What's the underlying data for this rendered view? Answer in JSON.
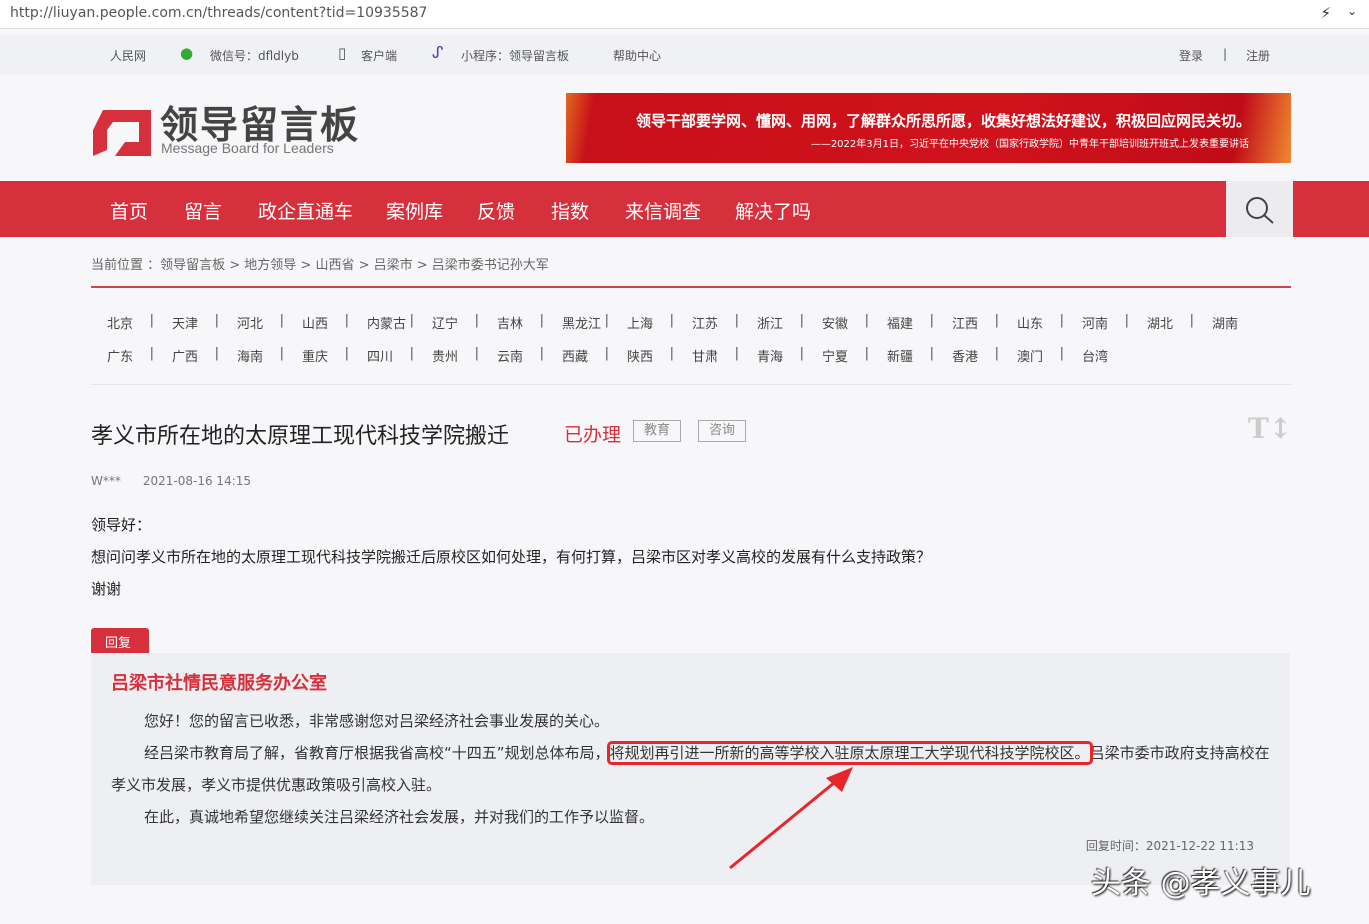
{
  "browser": {
    "url": "http://liuyan.people.com.cn/threads/content?tid=10935587"
  },
  "topbar": {
    "people": "人民网",
    "wechat": "微信号：dfldlyb",
    "client": "客户端",
    "miniprogram": "小程序：领导留言板",
    "help": "帮助中心",
    "login": "登录",
    "sep": "|",
    "register": "注册"
  },
  "logo": {
    "cn": "领导留言板",
    "en": "Message Board for Leaders"
  },
  "banner": {
    "line1": "领导干部要学网、懂网、用网，了解群众所思所愿，收集好想法好建议，积极回应网民关切。",
    "line2": "——2022年3月1日，习近平在中央党校（国家行政学院）中青年干部培训班开班式上发表重要讲话"
  },
  "nav": [
    "首页",
    "留言",
    "政企直通车",
    "案例库",
    "反馈",
    "指数",
    "来信调查",
    "解决了吗"
  ],
  "breadcrumb": "当前位置 ：领导留言板 > 地方领导 > 山西省 > 吕梁市 > 吕梁市委书记孙大军",
  "provinces_row1": [
    "北京",
    "天津",
    "河北",
    "山西",
    "内蒙古",
    "辽宁",
    "吉林",
    "黑龙江",
    "上海",
    "江苏",
    "浙江",
    "安徽",
    "福建",
    "江西",
    "山东",
    "河南",
    "湖北",
    "湖南"
  ],
  "provinces_row2": [
    "广东",
    "广西",
    "海南",
    "重庆",
    "四川",
    "贵州",
    "云南",
    "西藏",
    "陕西",
    "甘肃",
    "青海",
    "宁夏",
    "新疆",
    "香港",
    "澳门",
    "台湾"
  ],
  "thread": {
    "title": "孝义市所在地的太原理工现代科技学院搬迁",
    "status": "已办理",
    "tag1": "教育",
    "tag2": "咨询",
    "font_toggle": "T↕",
    "author": "W***",
    "time": "2021-08-16 14:15",
    "greeting": "领导好：",
    "content": "想问问孝义市所在地的太原理工现代科技学院搬迁后原校区如何处理，有何打算，吕梁市区对孝义高校的发展有什么支持政策？",
    "closing": "谢谢"
  },
  "reply": {
    "tab": "回复",
    "org": "吕梁市社情民意服务办公室",
    "p1": "您好！您的留言已收悉，非常感谢您对吕梁经济社会事业发展的关心。",
    "p2a": "经吕梁市教育局了解，省教育厅根据我省高校“十四五”规划总体布局，",
    "p2hl": "将规划再引进一所新的高等学校入驻原太原理工大学现代科技学院校区。",
    "p2b": "吕梁市委市政府支持高校在孝义市发展，孝义市提供优惠政策吸引高校入驻。",
    "p3": "在此，真诚地希望您继续关注吕梁经济社会发展，并对我们的工作予以监督。",
    "time": "回复时间：2021-12-22 11:13"
  },
  "watermark": "头条 @孝义事儿",
  "colors": {
    "brand": "#d7303d",
    "annotation": "#e8262a"
  }
}
